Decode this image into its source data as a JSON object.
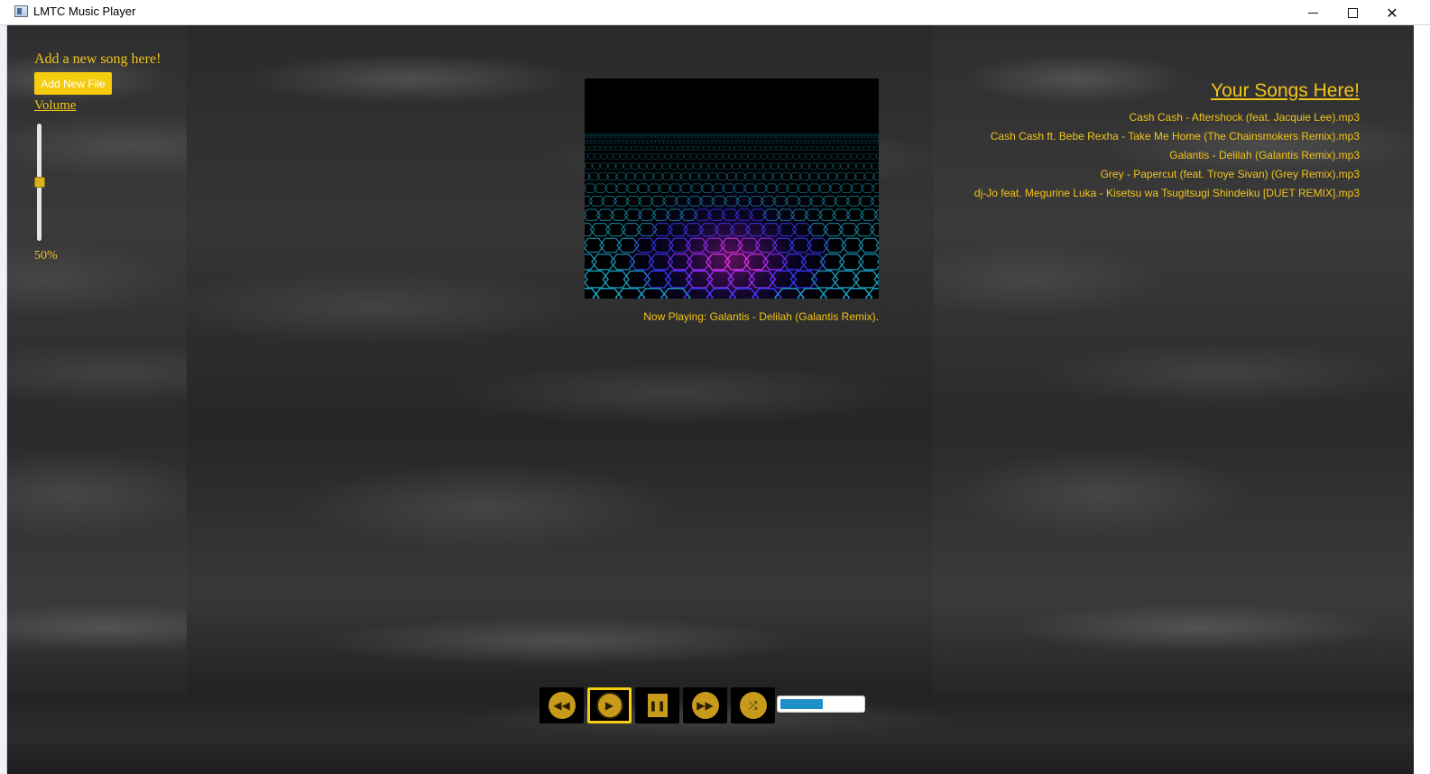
{
  "window": {
    "title": "LMTC Music Player"
  },
  "left": {
    "add_heading": "Add a new song here!",
    "add_button": "Add New File",
    "volume_label": "Volume",
    "volume_value": "50%",
    "volume_level": 0.5
  },
  "center": {
    "now_playing": "Now Playing: Galantis - Delilah (Galantis Remix)."
  },
  "right": {
    "heading": "Your Songs Here!",
    "songs": [
      "Cash Cash - Aftershock (feat. Jacquie Lee).mp3",
      "Cash Cash ft. Bebe Rexha - Take Me Home (The Chainsmokers Remix).mp3",
      "Galantis - Delilah (Galantis Remix).mp3",
      "Grey - Papercut (feat. Troye Sivan) (Grey Remix).mp3",
      "dj-Jo feat. Megurine Luka - Kisetsu wa Tsugitsugi Shindeiku [DUET REMIX].mp3"
    ]
  },
  "transport": {
    "progress": 0.52,
    "icons": [
      "rewind-icon",
      "play-icon",
      "pause-icon",
      "fast-forward-icon",
      "shuffle-icon"
    ]
  },
  "colors": {
    "accent": "#f2c419",
    "button": "#f5cc0e",
    "progress": "#1e8fc8"
  }
}
